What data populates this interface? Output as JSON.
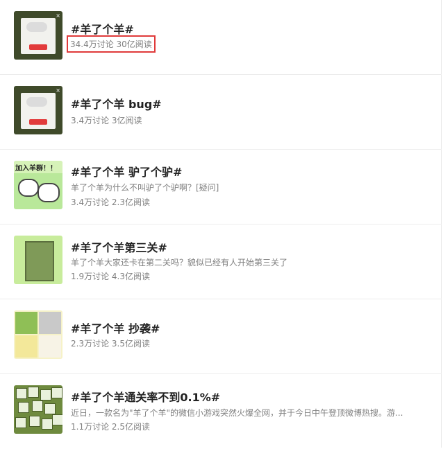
{
  "topics": [
    {
      "title": "#羊了个羊#",
      "desc": "",
      "stats": "34.4万讨论 30亿阅读",
      "highlighted": true,
      "thumb_icon": "sheep-game-card-icon"
    },
    {
      "title": "#羊了个羊 bug#",
      "desc": "",
      "stats": "3.4万讨论 3亿阅读",
      "highlighted": false,
      "thumb_icon": "sheep-game-card-icon"
    },
    {
      "title": "#羊了个羊 驴了个驴#",
      "desc": "羊了个羊为什么不叫驴了个驴啊？[疑问]",
      "stats": "3.4万讨论 2.3亿阅读",
      "highlighted": false,
      "thumb_icon": "sheep-cartoon-icon",
      "thumb_text": "加入羊群！！"
    },
    {
      "title": "#羊了个羊第三关#",
      "desc": "羊了个羊大家还卡在第二关吗？貌似已经有人开始第三关了",
      "stats": "1.9万讨论 4.3亿阅读",
      "highlighted": false,
      "thumb_icon": "game-board-icon"
    },
    {
      "title": "#羊了个羊 抄袭#",
      "desc": "",
      "stats": "2.3万讨论 3.5亿阅读",
      "highlighted": false,
      "thumb_icon": "game-comparison-icon"
    },
    {
      "title": "#羊了个羊通关率不到0.1%#",
      "desc": "近日，一款名为\"羊了个羊\"的微信小游戏突然火爆全网，并于今日中午登顶微博热搜。游...",
      "stats": "1.1万讨论 2.5亿阅读",
      "highlighted": false,
      "thumb_icon": "tile-grid-icon"
    }
  ],
  "colors": {
    "title": "#222222",
    "meta": "#808080",
    "highlight_border": "#e03a3a"
  }
}
